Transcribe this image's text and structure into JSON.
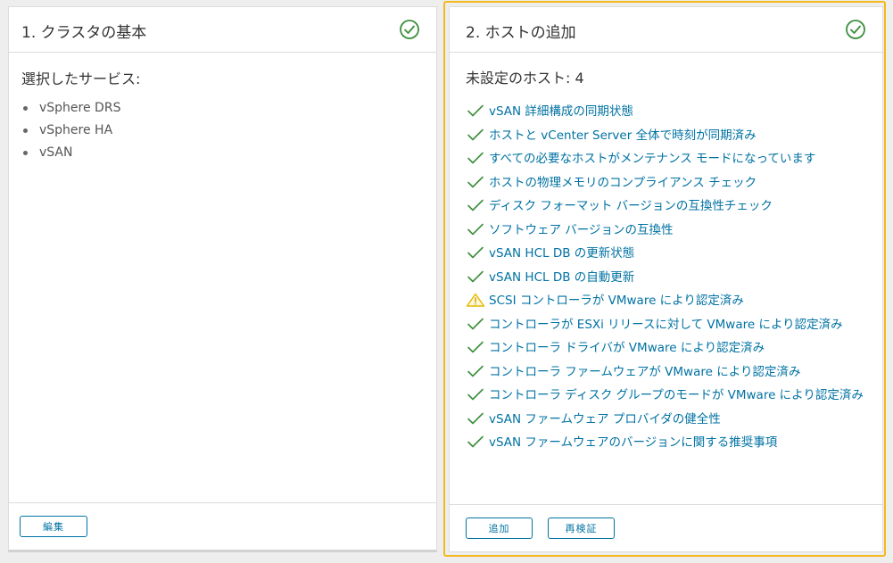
{
  "left_card": {
    "title": "1. クラスタの基本",
    "section_heading": "選択したサービス:",
    "services": [
      "vSphere DRS",
      "vSphere HA",
      "vSAN"
    ],
    "edit_label": "編集"
  },
  "right_card": {
    "title": "2. ホストの追加",
    "section_heading": "未設定のホスト: 4",
    "checks": [
      {
        "status": "pass",
        "label": "vSAN 詳細構成の同期状態"
      },
      {
        "status": "pass",
        "label": "ホストと vCenter Server 全体で時刻が同期済み"
      },
      {
        "status": "pass",
        "label": "すべての必要なホストがメンテナンス モードになっています"
      },
      {
        "status": "pass",
        "label": "ホストの物理メモリのコンプライアンス チェック"
      },
      {
        "status": "pass",
        "label": "ディスク フォーマット バージョンの互換性チェック"
      },
      {
        "status": "pass",
        "label": "ソフトウェア バージョンの互換性"
      },
      {
        "status": "pass",
        "label": "vSAN HCL DB の更新状態"
      },
      {
        "status": "pass",
        "label": "vSAN HCL DB の自動更新"
      },
      {
        "status": "warning",
        "label": "SCSI コントローラが VMware により認定済み"
      },
      {
        "status": "pass",
        "label": "コントローラが ESXi リリースに対して VMware により認定済み"
      },
      {
        "status": "pass",
        "label": "コントローラ ドライバが VMware により認定済み"
      },
      {
        "status": "pass",
        "label": "コントローラ ファームウェアが VMware により認定済み"
      },
      {
        "status": "pass",
        "label": "コントローラ ディスク グループのモードが VMware により認定済み"
      },
      {
        "status": "pass",
        "label": "vSAN ファームウェア プロバイダの健全性"
      },
      {
        "status": "pass",
        "label": "vSAN ファームウェアのバージョンに関する推奨事項"
      }
    ],
    "add_label": "追加",
    "revalidate_label": "再検証"
  },
  "colors": {
    "pass": "#3c8f3b",
    "warning": "#f5c400",
    "link": "#0072a3",
    "selected_outline": "#f3b91e"
  },
  "icons": {
    "header": "check-circle-icon",
    "pass": "checkmark-icon",
    "warning": "warning-triangle-icon"
  }
}
